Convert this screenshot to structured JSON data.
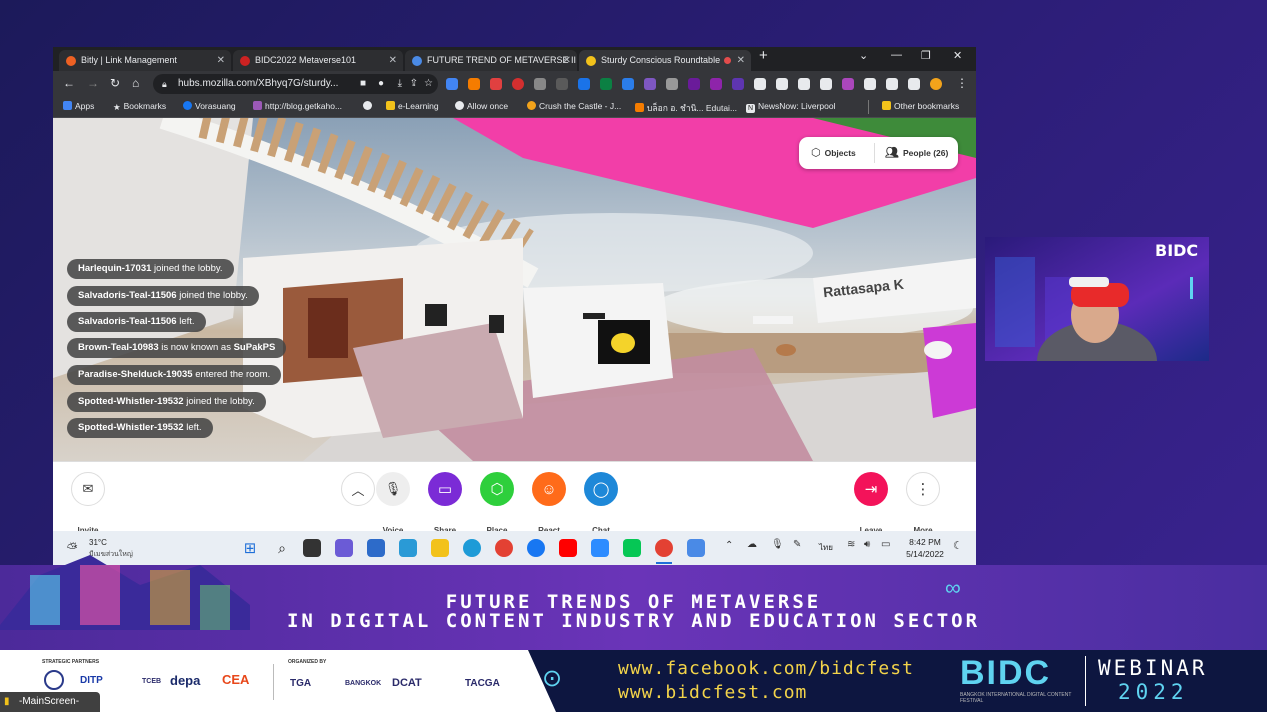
{
  "browser": {
    "tabs": [
      {
        "label": "Bitly | Link Management",
        "favicon_color": "#ee6123"
      },
      {
        "label": "BIDC2022 Metaverse101",
        "favicon_color": "#cc2222"
      },
      {
        "label": "FUTURE TREND OF METAVERSE II",
        "favicon_color": "#4a8ae6"
      },
      {
        "label": "Sturdy Conscious Roundtable",
        "favicon_color": "#f2c21b"
      }
    ],
    "url": "hubs.mozilla.com/XBhyq7G/sturdy...",
    "bookmarks": [
      {
        "label": "Apps",
        "color": "#4285f4"
      },
      {
        "label": "Bookmarks",
        "color": "#e8eaed"
      },
      {
        "label": "Vorasuang",
        "color": "#1877f2"
      },
      {
        "label": "http://blog.getkaho...",
        "color": "#9b59b6"
      },
      {
        "label": "",
        "color": "#e8eaed"
      },
      {
        "label": "e-Learning",
        "color": "#f2c21b"
      },
      {
        "label": "Allow once",
        "color": "#e8eaed"
      },
      {
        "label": "Crush the Castle - J...",
        "color": "#f2a31b"
      },
      {
        "label": "บล็อก อ. ชำนิ... Edutai...",
        "color": "#f57c00"
      },
      {
        "label": "NewsNow: Liverpool",
        "color": "#e8eaed"
      },
      {
        "label": "Other bookmarks",
        "color": "#f2c21b"
      }
    ]
  },
  "scene": {
    "notifications": [
      {
        "user": "Harlequin-17031",
        "text": " joined the lobby."
      },
      {
        "user": "Salvadoris-Teal-11506",
        "text": " joined the lobby."
      },
      {
        "user": "Salvadoris-Teal-11506",
        "text": " left."
      },
      {
        "user": "Brown-Teal-10983",
        "text": " is now known as ",
        "extra": "SuPakPS"
      },
      {
        "user": "Paradise-Shelduck-19035",
        "text": " entered the room."
      },
      {
        "user": "Spotted-Whistler-19532",
        "text": " joined the lobby."
      },
      {
        "user": "Spotted-Whistler-19532",
        "text": " left."
      }
    ],
    "objects_label": "Objects",
    "people_label": "People (26)",
    "avatar_name": "Rattasapa K"
  },
  "hubs_toolbar": {
    "invite": "Invite",
    "voice": "Voice",
    "share": "Share",
    "place": "Place",
    "react": "React",
    "chat": "Chat",
    "leave": "Leave",
    "more": "More",
    "colors": {
      "share": "#7b2bd6",
      "place": "#2ecf3c",
      "react": "#ff6b1a",
      "chat": "#1e88d8",
      "leave": "#f3135a"
    }
  },
  "taskbar": {
    "weather_temp": "31°C",
    "weather_desc": "มีเมฆส่วนใหญ่",
    "lang": "ไทย",
    "time": "8:42 PM",
    "date": "5/14/2022"
  },
  "cam": {
    "logo": "BIDC"
  },
  "banner": {
    "title_line1": "FUTURE TRENDS OF METAVERSE",
    "title_line2": "IN DIGITAL CONTENT INDUSTRY AND EDUCATION SECTOR",
    "strategic_partners": "STRATEGIC PARTNERS",
    "organized_by": "ORGANIZED BY",
    "partners_left": [
      "DITP",
      "TCEB",
      "depa",
      "CEA"
    ],
    "partners_right": [
      "TGA",
      "BANGKOK",
      "DCAT",
      "TACGA"
    ],
    "url_facebook": "www.facebook.com/bidcfest",
    "url_site": "www.bidcfest.com",
    "brand": "BIDC",
    "brand_sub": "BANGKOK INTERNATIONAL DIGITAL CONTENT FESTIVAL",
    "webinar": "WEBINAR",
    "year": "2022"
  },
  "overlay_label": "-MainScreen-"
}
